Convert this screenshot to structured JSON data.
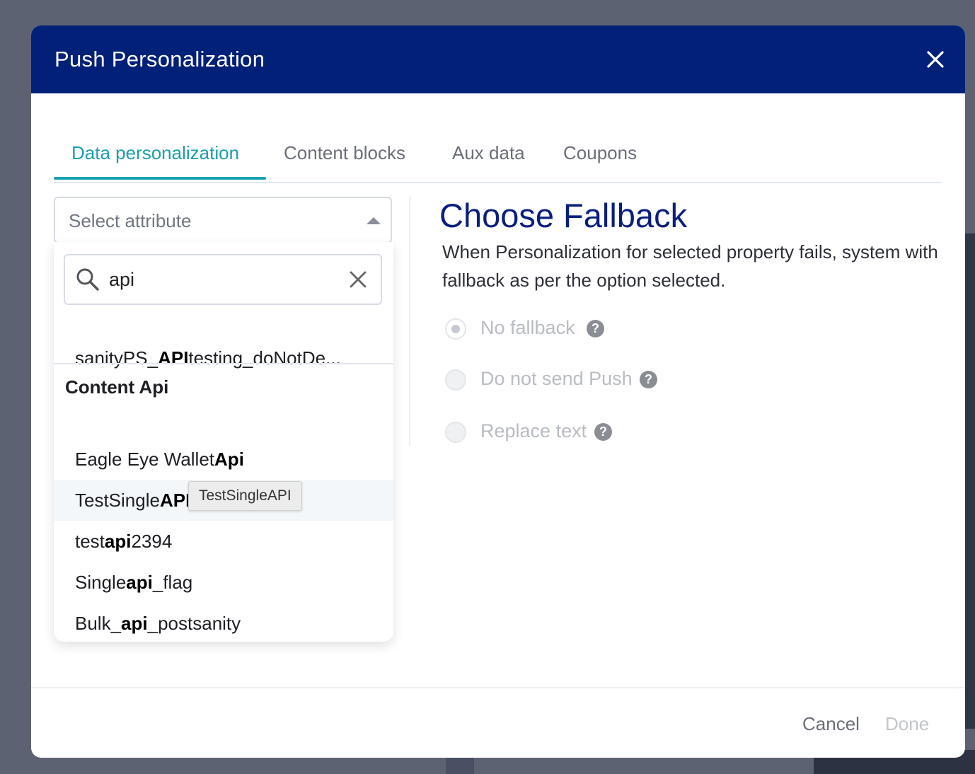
{
  "modal": {
    "title": "Push Personalization"
  },
  "tabs": [
    {
      "label": "Data personalization",
      "active": true
    },
    {
      "label": "Content blocks",
      "active": false
    },
    {
      "label": "Aux data",
      "active": false
    },
    {
      "label": "Coupons",
      "active": false
    }
  ],
  "attribute_select": {
    "placeholder": "Select attribute",
    "search_value": "api",
    "results": [
      {
        "pre": "sanityPS_",
        "match": "API",
        "post": "testing_doNotDe..."
      }
    ],
    "group": {
      "label": "Content Api",
      "items": [
        {
          "pre": "Eagle Eye Wallet",
          "match": "Api",
          "post": ""
        },
        {
          "pre": "TestSingle",
          "match": "API",
          "post": ""
        },
        {
          "pre": "test",
          "match": "api",
          "post": "2394"
        },
        {
          "pre": "Single",
          "match": "api",
          "post": "_flag"
        },
        {
          "pre": "Bulk_",
          "match": "api",
          "post": "_postsanity"
        }
      ]
    },
    "tooltip": "TestSingleAPI"
  },
  "fallback": {
    "title": "Choose Fallback",
    "description": "When Personalization for selected property fails, system with fallback as per the option selected.",
    "options": [
      {
        "label": "No fallback",
        "selected": true
      },
      {
        "label": "Do not send Push",
        "selected": false
      },
      {
        "label": "Replace text",
        "selected": false
      }
    ]
  },
  "footer": {
    "cancel_label": "Cancel",
    "done_label": "Done"
  },
  "colors": {
    "header_bg": "#012179",
    "accent": "#1aa0ae",
    "title_color": "#0a1f7c"
  },
  "icons": [
    "close-icon",
    "search-icon",
    "clear-icon",
    "caret-up-icon",
    "help-icon"
  ]
}
